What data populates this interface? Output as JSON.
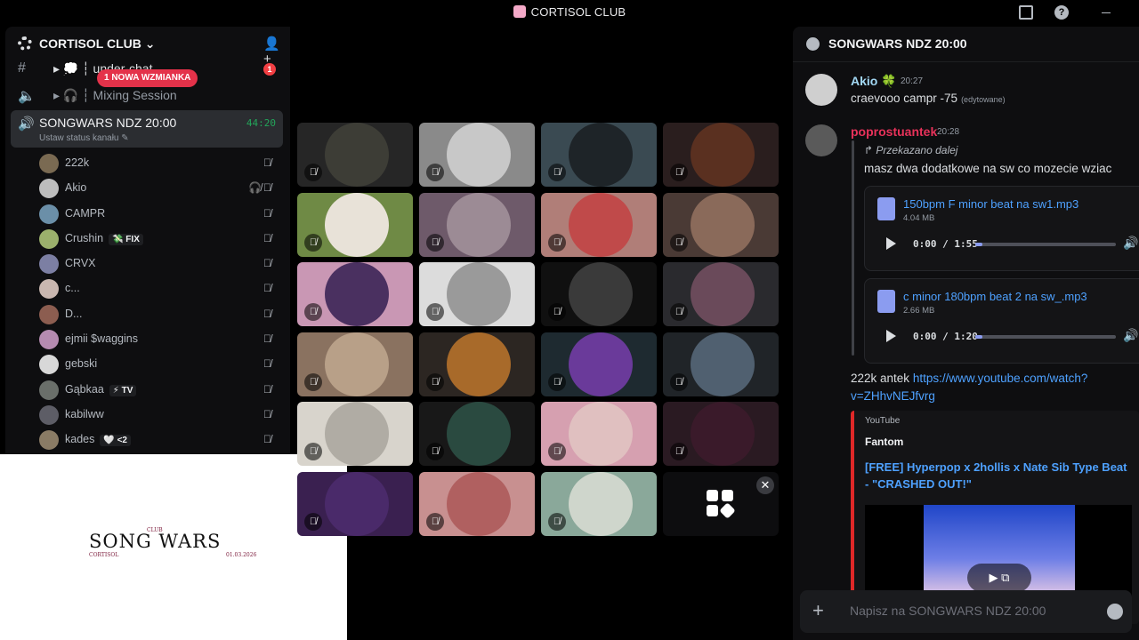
{
  "window": {
    "title": "CORTISOL CLUB"
  },
  "server": {
    "name": "CORTISOL CLUB"
  },
  "channels": [
    {
      "label": "▸ 💭 ┆ under-chat",
      "mentions": "1"
    },
    {
      "label": "▸ 🎧 ┆ Mixing Session"
    }
  ],
  "mention_pill": "1 NOWA WZMIANKA",
  "active_voice": {
    "name": "SONGWARS NDZ 20:00",
    "timer": "44:20",
    "status": "Ustaw status kanału ✎"
  },
  "members": [
    {
      "name": "222k",
      "tag": "",
      "color": "#7a6a52"
    },
    {
      "name": "Akio",
      "tag": "",
      "color": "#bdbdbd",
      "deafened": true
    },
    {
      "name": "CAMPR",
      "tag": "",
      "color": "#6b8fa8"
    },
    {
      "name": "Crushin",
      "tag": "💸 FIX",
      "color": "#9bb06c"
    },
    {
      "name": "CRVX",
      "tag": "",
      "color": "#7c7fa3"
    },
    {
      "name": "c...",
      "tag": "",
      "color": "#c9b7b0"
    },
    {
      "name": "D...",
      "tag": "",
      "color": "#8c5d50"
    },
    {
      "name": "ejmii $waggins",
      "tag": "",
      "color": "#b58bb0"
    },
    {
      "name": "gebski",
      "tag": "",
      "color": "#d8d8d8"
    },
    {
      "name": "Gąbkaa",
      "tag": "⚡ TV",
      "color": "#6a6f6a"
    },
    {
      "name": "kabilww",
      "tag": "",
      "color": "#5d5d66"
    },
    {
      "name": "kades",
      "tag": "🤍 <2",
      "color": "#8a7b65"
    }
  ],
  "overlay": {
    "club": "CLUB",
    "title": "SONG WARS",
    "sub": "CORTISOL",
    "date": "01.03.2026"
  },
  "tiles": [
    {
      "bg": "#262626",
      "c": "#3d3d36"
    },
    {
      "bg": "#8a8a8a",
      "c": "#c8c8c8"
    },
    {
      "bg": "#3a4a52",
      "c": "#1e2428"
    },
    {
      "bg": "#2a1e1e",
      "c": "#5a3020"
    },
    {
      "bg": "#6f8a45",
      "c": "#e8e2d8"
    },
    {
      "bg": "#6e5a6a",
      "c": "#9c8b95"
    },
    {
      "bg": "#b07e78",
      "c": "#c04a4a"
    },
    {
      "bg": "#4a3a35",
      "c": "#8a6a5a"
    },
    {
      "bg": "#c997b4",
      "c": "#4a3060"
    },
    {
      "bg": "#dcdcdc",
      "c": "#9a9a9a"
    },
    {
      "bg": "#101010",
      "c": "#3a3a3a"
    },
    {
      "bg": "#2a2a2e",
      "c": "#6a4a5a"
    },
    {
      "bg": "#8a7260",
      "c": "#b8a088"
    },
    {
      "bg": "#2c2622",
      "c": "#a86a2a"
    },
    {
      "bg": "#1e2a30",
      "c": "#6a3a9a"
    },
    {
      "bg": "#202428",
      "c": "#506070"
    },
    {
      "bg": "#d8d4cc",
      "c": "#b0aca4"
    },
    {
      "bg": "#181818",
      "c": "#2a4a40"
    },
    {
      "bg": "#d6a0b0",
      "c": "#e0c0c0"
    },
    {
      "bg": "#2a1a22",
      "c": "#3a1a2a"
    },
    {
      "bg": "#3a2050",
      "c": "#4a2a6a"
    },
    {
      "bg": "#c89090",
      "c": "#b06060"
    },
    {
      "bg": "#8aa89a",
      "c": "#cfd6cc"
    },
    {
      "bg": "#0d0d0f",
      "c": ""
    }
  ],
  "chat": {
    "channel": "SONGWARS NDZ 20:00",
    "m1": {
      "user": "Akio 🍀",
      "time": "20:27",
      "text": "craevooo campr -75",
      "edited": "(edytowane)"
    },
    "m2": {
      "user": "poprostuantek",
      "time": "20:28",
      "forwarded": "↱ Przekazano dalej",
      "text": "masz dwa dodatkowe na sw co mozecie wziac"
    },
    "files": [
      {
        "name": "150bpm F minor beat na sw1.mp3",
        "size": "4.04 MB",
        "time": "0:00 / 1:55",
        "progress": 0.05
      },
      {
        "name": "c minor 180bpm beat 2 na sw_.mp3",
        "size": "2.66 MB",
        "time": "0:00 / 1:20",
        "progress": 0.05
      }
    ],
    "m3": {
      "prefix": "222k antek ",
      "url1": "https://www.youtube.com/watch?",
      "url2": "v=ZHhvNEJfvrg"
    },
    "embed": {
      "provider": "YouTube",
      "author": "Fantom",
      "title": "[FREE] Hyperpop x 2hollis x Nate Sib Type Beat - \"CRASHED OUT!\""
    },
    "composer_placeholder": "Napisz na SONGWARS NDZ 20:00"
  },
  "colors": {
    "accent_red": "#e02828",
    "link": "#4ea1ff",
    "voice_green": "#23a55a"
  }
}
